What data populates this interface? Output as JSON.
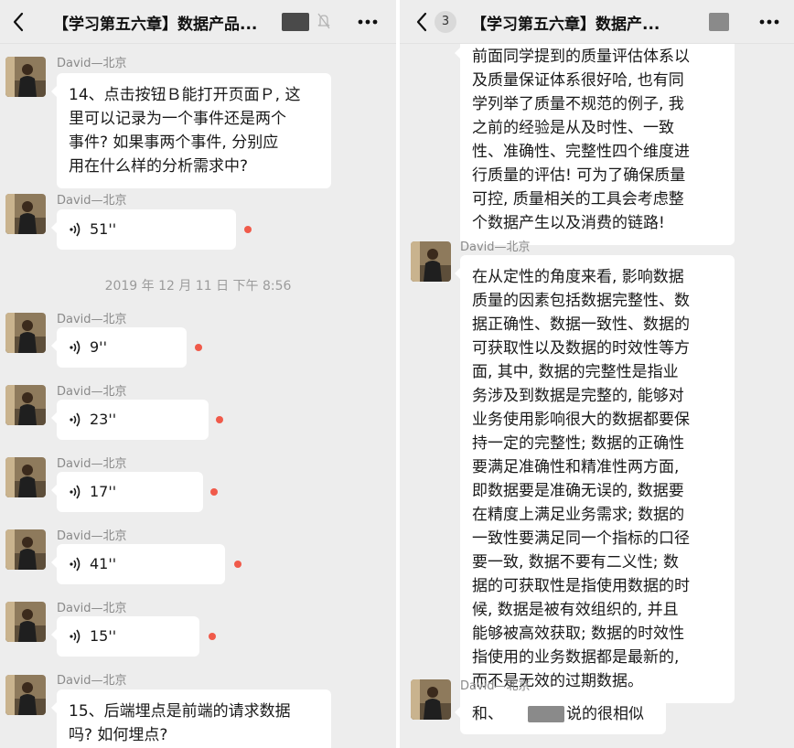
{
  "colors": {
    "background": "#ededed",
    "bubble": "#ffffff",
    "unread_dot": "#f05a4a",
    "divider": "#ffffff"
  },
  "icons": {
    "back": "chevron-left-icon",
    "mute": "mute-bell-icon",
    "more": "more-dots-icon",
    "voice": "voice-wave-icon",
    "avatar": "profile-photo"
  },
  "left": {
    "nav": {
      "title": "【学习第五六章】数据产品..."
    },
    "messages": [
      {
        "type": "text",
        "sender": "David—北京",
        "text": "14、点击按钮Ｂ能打开页面Ｐ, 这\n里可以记录为一个事件还是两个\n事件? 如果事两个事件, 分别应\n用在什么样的分析需求中?"
      },
      {
        "type": "voice",
        "sender": "David—北京",
        "duration": "51''"
      },
      {
        "type": "voice",
        "sender": "David—北京",
        "duration": "9''"
      },
      {
        "type": "voice",
        "sender": "David—北京",
        "duration": "23''"
      },
      {
        "type": "voice",
        "sender": "David—北京",
        "duration": "17''"
      },
      {
        "type": "voice",
        "sender": "David—北京",
        "duration": "41''"
      },
      {
        "type": "voice",
        "sender": "David—北京",
        "duration": "15''"
      },
      {
        "type": "text",
        "sender": "David—北京",
        "text": "15、后端埋点是前端的请求数据\n吗? 如何埋点?"
      }
    ],
    "timestamp": "2019 年 12 月 11 日  下午 8:56"
  },
  "right": {
    "nav": {
      "title": "【学习第五六章】数据产...",
      "unread_count": "3"
    },
    "messages": [
      {
        "type": "text",
        "text": "前面同学提到的质量评估体系以\n及质量保证体系很好哈, 也有同\n学列举了质量不规范的例子, 我\n之前的经验是从及时性、一致\n性、准确性、完整性四个维度进\n行质量的评估! 可为了确保质量\n可控, 质量相关的工具会考虑整\n个数据产生以及消费的链路!"
      },
      {
        "type": "text",
        "sender": "David—北京",
        "text": "在从定性的角度来看, 影响数据\n质量的因素包括数据完整性、数\n据正确性、数据一致性、数据的\n可获取性以及数据的时效性等方\n面, 其中, 数据的完整性是指业\n务涉及到数据是完整的, 能够对\n业务使用影响很大的数据都要保\n持一定的完整性; 数据的正确性\n要满足准确性和精准性两方面,\n即数据要是准确无误的, 数据要\n在精度上满足业务需求; 数据的\n一致性要满足同一个指标的口径\n要一致, 数据不要有二义性; 数\n据的可获取性是指使用数据的时\n候, 数据是被有效组织的, 并且\n能够被高效获取; 数据的时效性\n指使用的业务数据都是最新的,\n而不是无效的过期数据。"
      },
      {
        "type": "text",
        "sender": "David—北京",
        "text_before": "和、",
        "text_after": "说的很相似"
      }
    ]
  }
}
